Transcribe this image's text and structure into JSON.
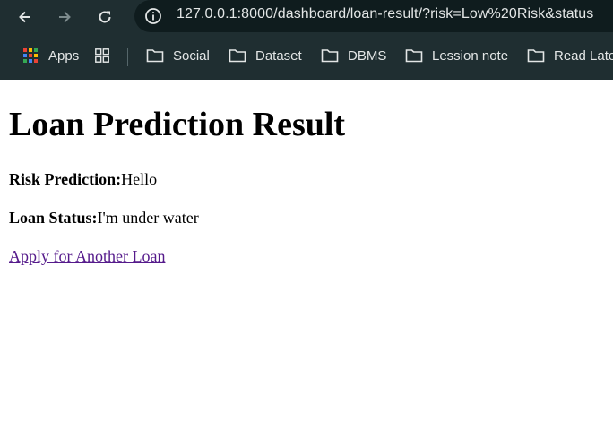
{
  "browser": {
    "url": "127.0.0.1:8000/dashboard/loan-result/?risk=Low%20Risk&status",
    "bookmarks": {
      "apps_label": "Apps",
      "items": [
        "Social",
        "Dataset",
        "DBMS",
        "Lession note",
        "Read Later"
      ]
    }
  },
  "page": {
    "title": "Loan Prediction Result",
    "risk_label": "Risk Prediction:",
    "risk_value": "Hello",
    "status_label": "Loan Status:",
    "status_value": "I'm under water",
    "apply_link": "Apply for Another Loan"
  },
  "colors": {
    "chrome_bg": "#1f2e31",
    "link_visited": "#551a8b"
  }
}
